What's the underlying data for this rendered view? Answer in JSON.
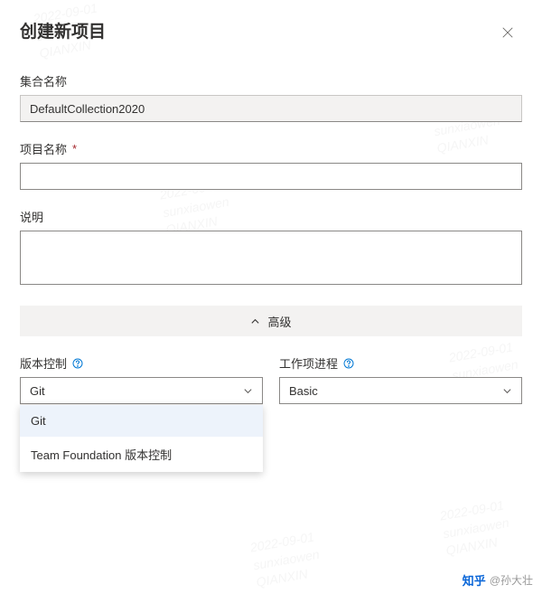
{
  "dialog": {
    "title": "创建新项目"
  },
  "fields": {
    "collection": {
      "label": "集合名称",
      "value": "DefaultCollection2020"
    },
    "projectName": {
      "label": "项目名称",
      "value": ""
    },
    "description": {
      "label": "说明",
      "value": ""
    },
    "versionControl": {
      "label": "版本控制",
      "value": "Git",
      "options": [
        "Git",
        "Team Foundation 版本控制"
      ]
    },
    "workItemProcess": {
      "label": "工作项进程",
      "value": "Basic"
    }
  },
  "advanced": {
    "label": "高级"
  },
  "attribution": {
    "site": "知乎",
    "handle": "@孙大壮"
  },
  "watermark": {
    "date": "2022-09-01",
    "author": "sunxiaowen",
    "org": "QIANXIN"
  }
}
